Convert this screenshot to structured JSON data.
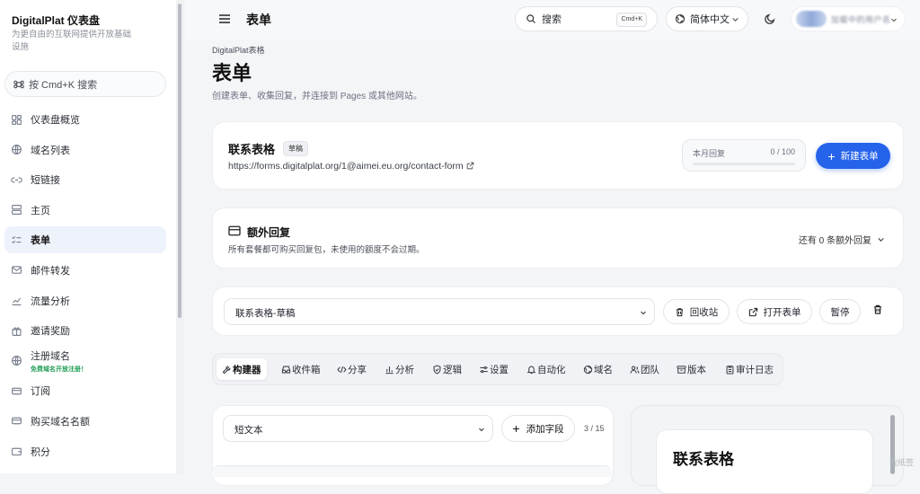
{
  "sidebar": {
    "brand": "DigitalPlat 仪表盘",
    "brand_sub": "为更自由的互联网提供开放基础设施",
    "search_label": "按 Cmd+K 搜索",
    "items": [
      {
        "label": "仪表盘概览",
        "icon": "dashboard-icon"
      },
      {
        "label": "域名列表",
        "icon": "globe-icon"
      },
      {
        "label": "短链接",
        "icon": "link-icon"
      },
      {
        "label": "主页",
        "icon": "layout-icon"
      },
      {
        "label": "表单",
        "icon": "form-list-icon",
        "active": true
      },
      {
        "label": "邮件转发",
        "icon": "mail-icon"
      },
      {
        "label": "流量分析",
        "icon": "chart-icon"
      },
      {
        "label": "邀请奖励",
        "icon": "gift-icon"
      },
      {
        "label": "注册域名",
        "icon": "globe-icon",
        "badge": "免费域名开放注册！"
      },
      {
        "label": "订阅",
        "icon": "card-icon"
      },
      {
        "label": "购买域名名额",
        "icon": "card-icon"
      },
      {
        "label": "积分",
        "icon": "wallet-icon"
      }
    ]
  },
  "topbar": {
    "title": "表单",
    "search_label": "搜索",
    "search_kbd": "Cmd+K",
    "language": "简体中文",
    "user_name": "加载中的用户名"
  },
  "header": {
    "breadcrumb": "DigitalPlat表格",
    "title": "表单",
    "subtitle": "创建表单、收集回复，并连接到 Pages 或其他网站。"
  },
  "form_card": {
    "name": "联系表格",
    "status": "草稿",
    "url": "https://forms.digitalplat.org/1@aimei.eu.org/contact-form",
    "usage_label": "本月回复",
    "usage_count": "0 / 100",
    "usage_fraction": 0,
    "new_button": "新建表单"
  },
  "extra_card": {
    "title": "额外回复",
    "desc": "所有套餐都可购买回复包，未使用的额度不会过期。",
    "remaining": "还有 0 条额外回复"
  },
  "actions": {
    "selected_form": "联系表格-草稿",
    "recycle": "回收站",
    "open_form": "打开表单",
    "pause": "暂停"
  },
  "tabs": [
    {
      "label": "构建器",
      "icon": "hammer-icon",
      "active": true
    },
    {
      "label": "收件箱",
      "icon": "inbox-icon"
    },
    {
      "label": "分享",
      "icon": "code-icon"
    },
    {
      "label": "分析",
      "icon": "bar-chart-icon"
    },
    {
      "label": "逻辑",
      "icon": "shield-icon"
    },
    {
      "label": "设置",
      "icon": "sliders-icon"
    },
    {
      "label": "自动化",
      "icon": "bell-icon"
    },
    {
      "label": "域名",
      "icon": "globe-icon"
    },
    {
      "label": "团队",
      "icon": "users-icon"
    },
    {
      "label": "版本",
      "icon": "archive-icon"
    },
    {
      "label": "审计日志",
      "icon": "clipboard-icon"
    }
  ],
  "builder": {
    "field_type": "短文本",
    "add_field": "添加字段",
    "field_count": "3 / 15"
  },
  "preview": {
    "title": "联系表格"
  },
  "watermark": "我纸签",
  "colors": {
    "accent": "#2563eb",
    "active_nav_bg": "#eef2fb",
    "badge_green": "#1f9d55"
  }
}
